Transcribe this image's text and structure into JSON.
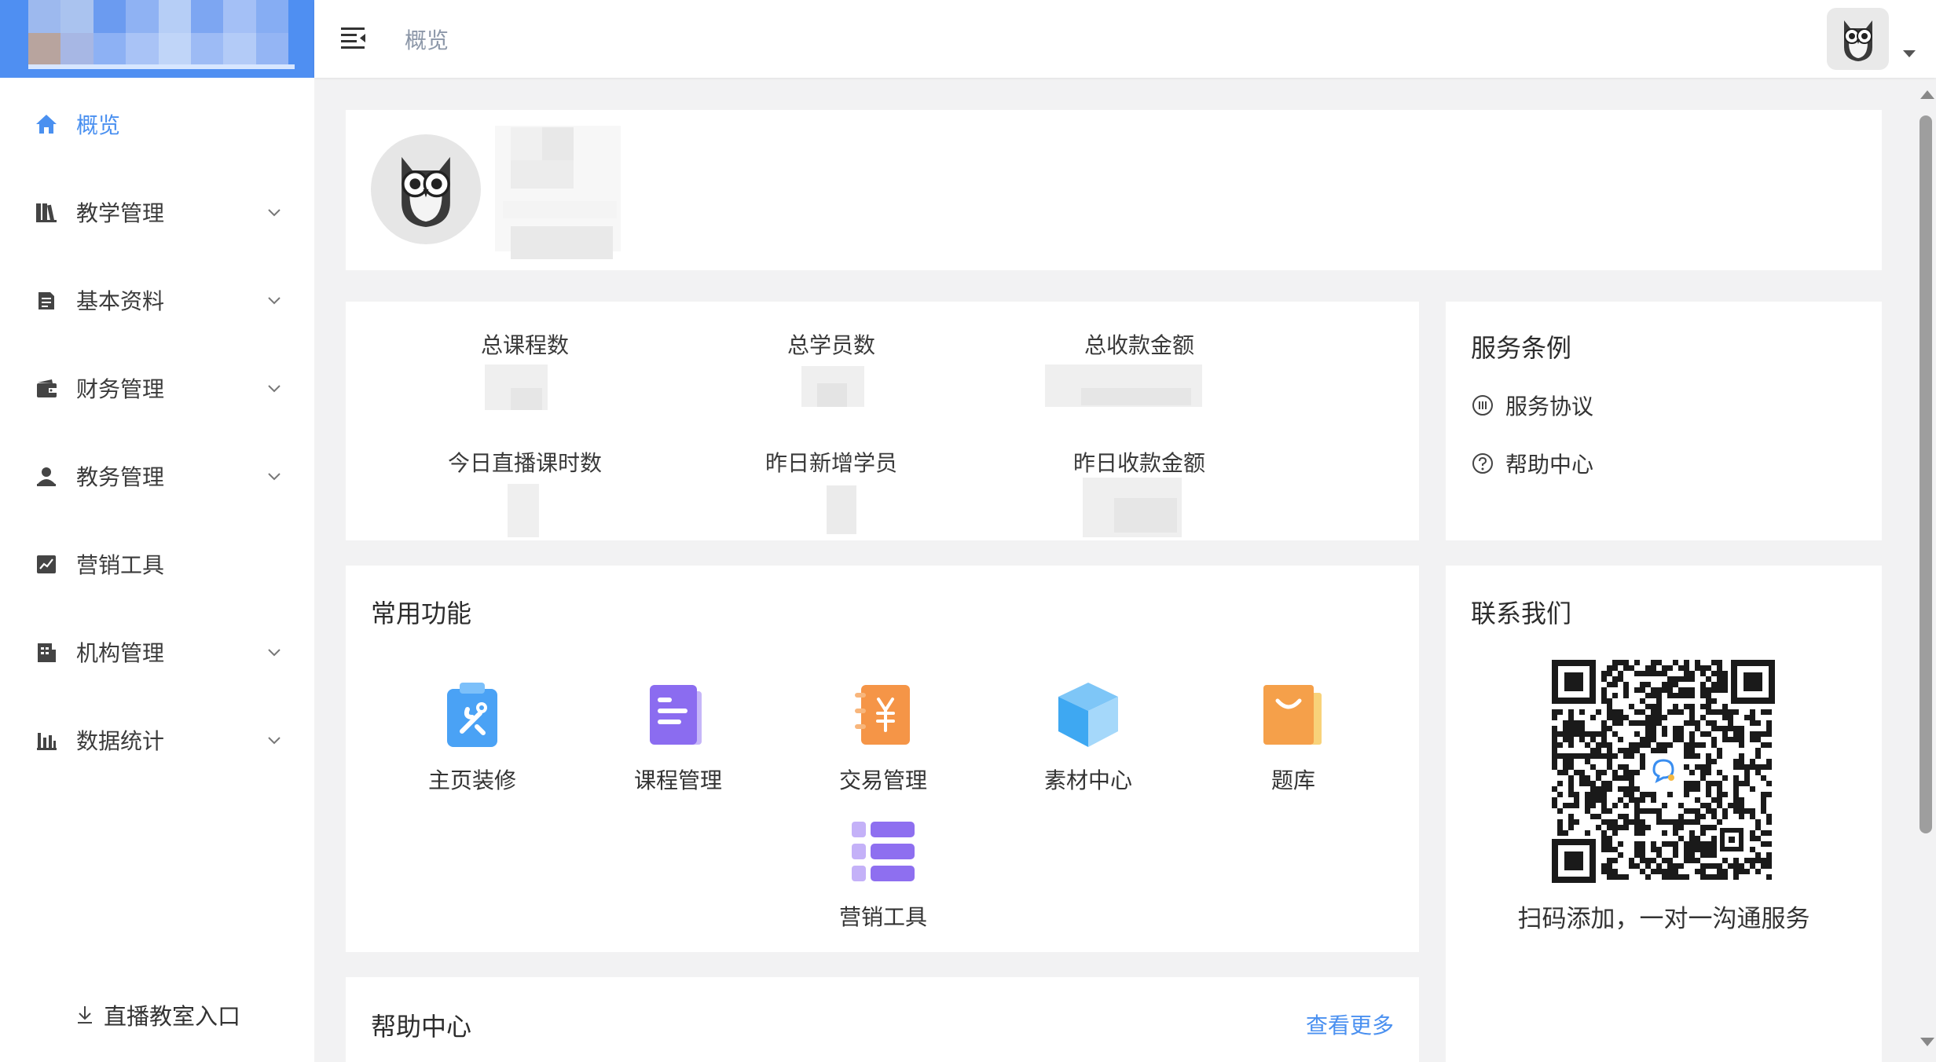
{
  "sidebar": {
    "items": [
      {
        "label": "概览",
        "icon": "home-icon",
        "active": true,
        "expandable": false
      },
      {
        "label": "教学管理",
        "icon": "books-icon",
        "active": false,
        "expandable": true
      },
      {
        "label": "基本资料",
        "icon": "document-icon",
        "active": false,
        "expandable": true
      },
      {
        "label": "财务管理",
        "icon": "wallet-icon",
        "active": false,
        "expandable": true
      },
      {
        "label": "教务管理",
        "icon": "user-icon",
        "active": false,
        "expandable": true
      },
      {
        "label": "营销工具",
        "icon": "chart-line-icon",
        "active": false,
        "expandable": false
      },
      {
        "label": "机构管理",
        "icon": "building-icon",
        "active": false,
        "expandable": true
      },
      {
        "label": "数据统计",
        "icon": "bar-chart-icon",
        "active": false,
        "expandable": true
      }
    ],
    "live_entry": "直播教室入口"
  },
  "header": {
    "breadcrumb": "概览"
  },
  "stats": {
    "labels": [
      "总课程数",
      "总学员数",
      "总收款金额",
      "今日直播课时数",
      "昨日新增学员",
      "昨日收款金额"
    ]
  },
  "service": {
    "title": "服务条例",
    "links": [
      "服务协议",
      "帮助中心"
    ]
  },
  "functions": {
    "title": "常用功能",
    "items": [
      {
        "label": "主页装修",
        "icon": "tools-clipboard-icon",
        "color": "#4aa2f5"
      },
      {
        "label": "课程管理",
        "icon": "course-book-icon",
        "color": "#8b6cf0"
      },
      {
        "label": "交易管理",
        "icon": "yuan-notebook-icon",
        "color": "#f59547"
      },
      {
        "label": "素材中心",
        "icon": "cube-box-icon",
        "color": "#3ea8f2"
      },
      {
        "label": "题库",
        "icon": "shopping-bag-icon",
        "color": "#f5a04a"
      },
      {
        "label": "营销工具",
        "icon": "list-rows-icon",
        "color": "#8e6ff0"
      }
    ]
  },
  "contact": {
    "title": "联系我们",
    "caption": "扫码添加，一对一沟通服务"
  },
  "help": {
    "title": "帮助中心",
    "more": "查看更多"
  },
  "colors": {
    "accent": "#4a90f0",
    "logo_bg": "#4f8ff2"
  }
}
